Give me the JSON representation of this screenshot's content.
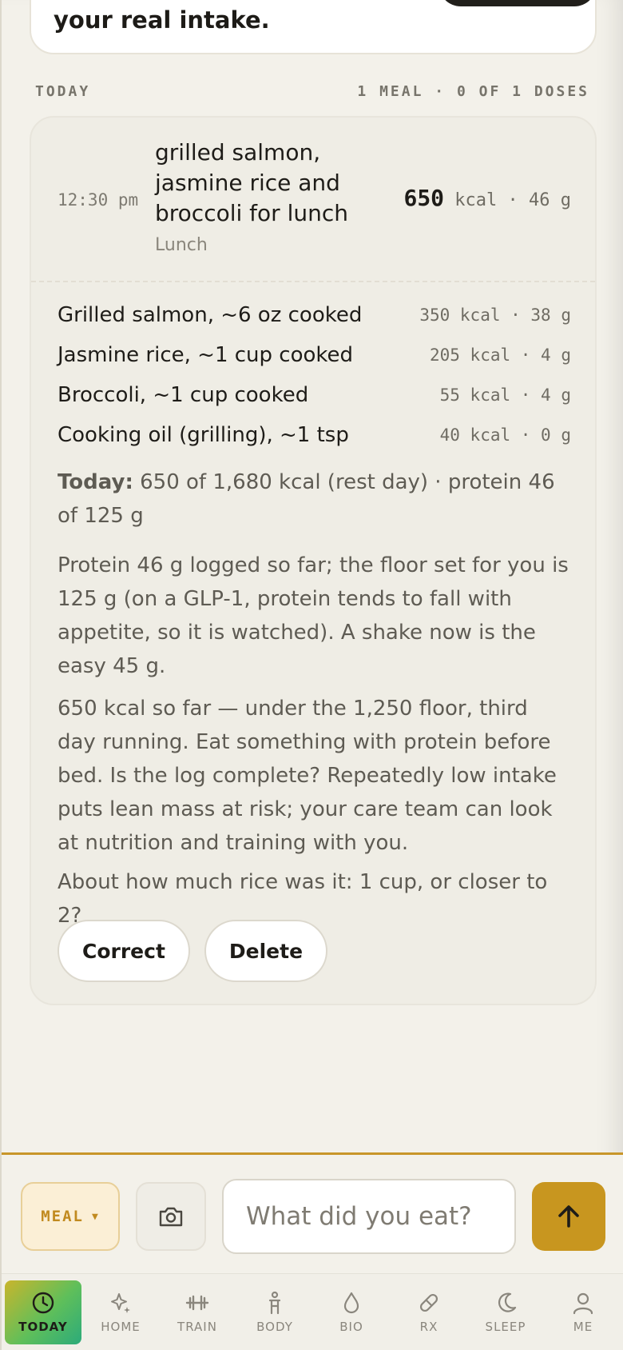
{
  "top_card": {
    "title": "your real intake."
  },
  "section": {
    "label": "TODAY",
    "summary": "1 MEAL · 0 OF 1 DOSES"
  },
  "meal": {
    "time": "12:30 pm",
    "name": "grilled salmon, jasmine rice and broccoli for lunch",
    "type": "Lunch",
    "total_kcal": "650",
    "total_rest": "kcal · 46 g",
    "items": [
      {
        "name": "Grilled salmon, ~6 oz cooked",
        "value": "350 kcal · 38 g"
      },
      {
        "name": "Jasmine rice, ~1 cup cooked",
        "value": "205 kcal · 4 g"
      },
      {
        "name": "Broccoli, ~1 cup cooked",
        "value": "55 kcal · 4 g"
      },
      {
        "name": "Cooking oil (grilling), ~1 tsp",
        "value": "40 kcal · 0 g"
      }
    ],
    "today_label": "Today:",
    "today_text": "650 of 1,680 kcal (rest day) · protein 46 of 125 g",
    "protein_note": "Protein 46 g logged so far; the floor set for you is 125 g (on a GLP-1, protein tends to fall with appetite, so it is watched). A shake now is the easy 45 g.",
    "intake_note": "650 kcal so far — under the 1,250 floor, third day running. Eat something with protein before bed. Is the log complete? Repeatedly low intake puts lean mass at risk; your care team can look at nutrition and training with you.",
    "question": "About how much rice was it: 1 cup, or closer to 2?",
    "correct_label": "Correct",
    "delete_label": "Delete"
  },
  "composer": {
    "meal_select": "MEAL",
    "input_placeholder": "What did you eat?",
    "accent": "#c8961f"
  },
  "nav": {
    "items": [
      {
        "label": "TODAY",
        "icon": "clock-icon",
        "active": true
      },
      {
        "label": "HOME",
        "icon": "sparkle-icon"
      },
      {
        "label": "TRAIN",
        "icon": "dumbbell-icon"
      },
      {
        "label": "BODY",
        "icon": "body-icon"
      },
      {
        "label": "BIO",
        "icon": "drop-icon"
      },
      {
        "label": "RX",
        "icon": "pill-icon"
      },
      {
        "label": "SLEEP",
        "icon": "moon-icon"
      },
      {
        "label": "ME",
        "icon": "person-icon"
      }
    ]
  }
}
